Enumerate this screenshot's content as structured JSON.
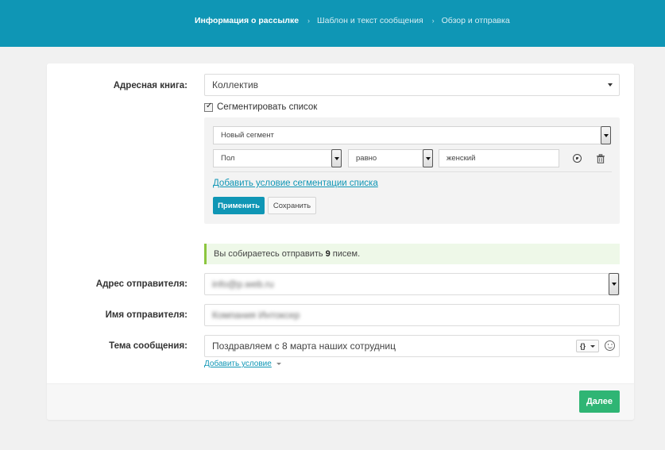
{
  "steps": [
    {
      "label": "Информация о рассылке",
      "active": true
    },
    {
      "label": "Шаблон и текст сообщения",
      "active": false
    },
    {
      "label": "Обзор и отправка",
      "active": false
    }
  ],
  "step_separator": "›",
  "form": {
    "address_book": {
      "label": "Адресная книга:",
      "value": "Коллектив"
    },
    "segment_checkbox": {
      "label": "Сегментировать список",
      "checked": true
    },
    "segment": {
      "segment_select": "Новый сегмент",
      "field_select": "Пол",
      "operator_select": "равно",
      "value_input": "женский",
      "add_condition_link": "Добавить условие сегментации списка",
      "apply_button": "Применить",
      "save_button": "Сохранить"
    },
    "notice": {
      "prefix": "Вы собираетесь отправить",
      "count": "9",
      "suffix": "писем."
    },
    "sender_address": {
      "label": "Адрес отправителя:",
      "value": "info@p.web.ru"
    },
    "sender_name": {
      "label": "Имя отправителя:",
      "value": "Компания Интоксер"
    },
    "subject": {
      "label": "Тема сообщения:",
      "value": "Поздравляем с 8 марта наших сотрудниц",
      "var_button": "{}"
    },
    "add_condition": "Добавить условие"
  },
  "footer": {
    "next_button": "Далее"
  },
  "colors": {
    "brand": "#0f96b5",
    "success": "#2fb574",
    "notice_border": "#8cc63f"
  },
  "icons": [
    "chevron-right-icon",
    "caret-down-icon",
    "checkbox-icon",
    "plus-circle-icon",
    "trash-icon",
    "variables-icon",
    "smile-icon"
  ]
}
